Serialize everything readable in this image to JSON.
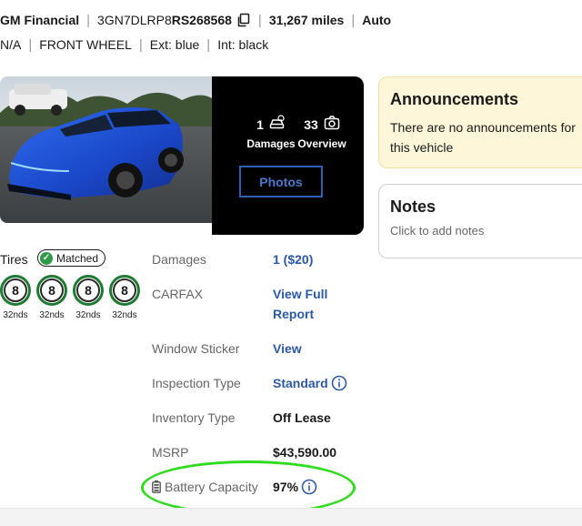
{
  "vehicle": {
    "seller": "GM Financial",
    "vin_prefix": "3GN7DLRP8",
    "vin_suffix": "RS268568",
    "mileage": "31,267 miles",
    "transmission": "Auto",
    "engine": "N/A",
    "drive": "FRONT WHEEL",
    "exterior": "Ext: blue",
    "interior": "Int: black"
  },
  "media": {
    "damages_count": "1",
    "damages_label": "Damages",
    "overview_count": "33",
    "overview_label": "Overview",
    "photos_button": "Photos"
  },
  "announcements": {
    "title": "Announcements",
    "body": "There are no announcements for this vehicle"
  },
  "notes": {
    "title": "Notes",
    "placeholder": "Click to add notes"
  },
  "tires": {
    "label": "Tires",
    "status": "Matched",
    "items": [
      {
        "value": "8",
        "unit": "32nds"
      },
      {
        "value": "8",
        "unit": "32nds"
      },
      {
        "value": "8",
        "unit": "32nds"
      },
      {
        "value": "8",
        "unit": "32nds"
      }
    ]
  },
  "details": {
    "damages_label": "Damages",
    "damages_value": "1 ($20)",
    "carfax_label": "CARFAX",
    "carfax_value_line1": "View Full",
    "carfax_value_line2": "Report",
    "window_sticker_label": "Window Sticker",
    "window_sticker_value": "View",
    "inspection_type_label": "Inspection Type",
    "inspection_type_value": "Standard",
    "inventory_type_label": "Inventory Type",
    "inventory_type_value": "Off Lease",
    "msrp_label": "MSRP",
    "msrp_value": "$43,590.00",
    "battery_label": "Battery Capacity",
    "battery_value": "97%"
  },
  "colors": {
    "link": "#2c5aa8",
    "tire_ring": "#1f7a33",
    "highlight": "#2edc1b",
    "announce_bg": "#fdf6d9"
  },
  "icons": [
    "copy-icon",
    "damage-icon",
    "camera-icon",
    "check-icon",
    "info-icon",
    "battery-icon"
  ]
}
